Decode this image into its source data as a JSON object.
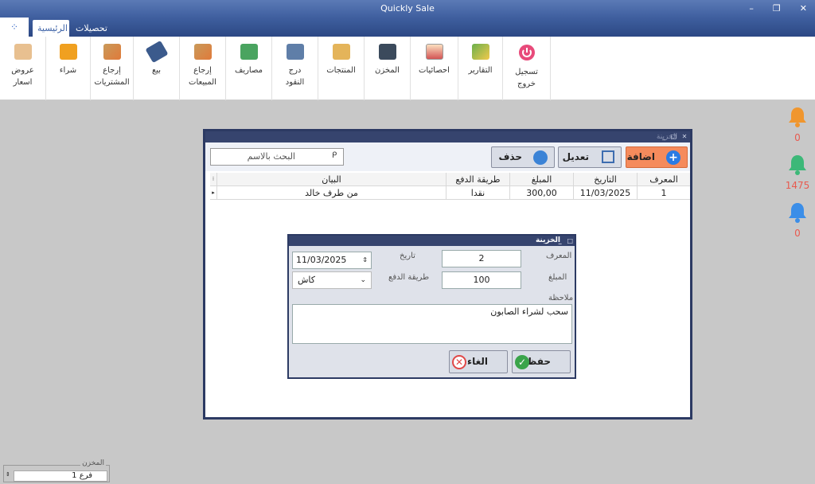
{
  "app": {
    "title": "Quickly Sale",
    "tabs": [
      "الرئيسية",
      "تحصيلات"
    ]
  },
  "ribbon": [
    {
      "label": "تسجيل\nخروج",
      "icon": "power-icon",
      "color": "#e84a7a"
    },
    {
      "label": "التقارير",
      "icon": "reports-icon",
      "color": "#6ab04c"
    },
    {
      "label": "احصائيات",
      "icon": "statistics-icon",
      "color": "#d35454"
    },
    {
      "label": "المخزن",
      "icon": "warehouse-icon",
      "color": "#3b4a5c"
    },
    {
      "label": "المنتجات",
      "icon": "products-icon",
      "color": "#e4b45a"
    },
    {
      "label": "درج\nالنقود",
      "icon": "cash-drawer-icon",
      "color": "#5f7ea8"
    },
    {
      "label": "مصاريف",
      "icon": "expenses-icon",
      "color": "#4aa460"
    },
    {
      "label": "إرجاع\nالمبيعات",
      "icon": "sales-return-icon",
      "color": "#e07a3a"
    },
    {
      "label": "بيع",
      "icon": "sale-tag-icon",
      "color": "#3b5a8c"
    },
    {
      "label": "إرجاع\nالمشتريات",
      "icon": "purchase-return-icon",
      "color": "#e07a3a"
    },
    {
      "label": "شراء",
      "icon": "cart-icon",
      "color": "#f0a020"
    },
    {
      "label": "عروض\nاسعار",
      "icon": "quotes-icon",
      "color": "#e8c090"
    }
  ],
  "notifications": [
    {
      "count": "0",
      "color": "#f0962e"
    },
    {
      "count": "1475",
      "color": "#3cb878"
    },
    {
      "count": "0",
      "color": "#3b8ee8"
    }
  ],
  "main_window": {
    "title": "الخزينة",
    "search_placeholder": "البحث بالاسم",
    "add_label": "اضافة",
    "edit_label": "تعديل",
    "delete_label": "حذف",
    "columns": [
      "المعرف",
      "التاريخ",
      "المبلغ",
      "طريقة الدفع",
      "البيان"
    ],
    "rows": [
      {
        "id": "1",
        "date": "11/03/2025",
        "amount": "300,00",
        "payment": "نقدا",
        "description": "من طرف خالد"
      }
    ]
  },
  "dialog": {
    "title": "الخزينة",
    "id_label": "المعرف",
    "id_value": "2",
    "date_label": "تاريخ",
    "date_value": "11/03/2025",
    "amount_label": "المبلغ",
    "amount_value": "100",
    "payment_label": "طريقة الدفع",
    "payment_value": "كاش",
    "note_label": "ملاحظة",
    "note_value": "سحب لشراء الصابون",
    "save_label": "حفظ",
    "cancel_label": "الغاء"
  },
  "status": {
    "store_label": "المخزن",
    "store_value": "فرع 1"
  }
}
